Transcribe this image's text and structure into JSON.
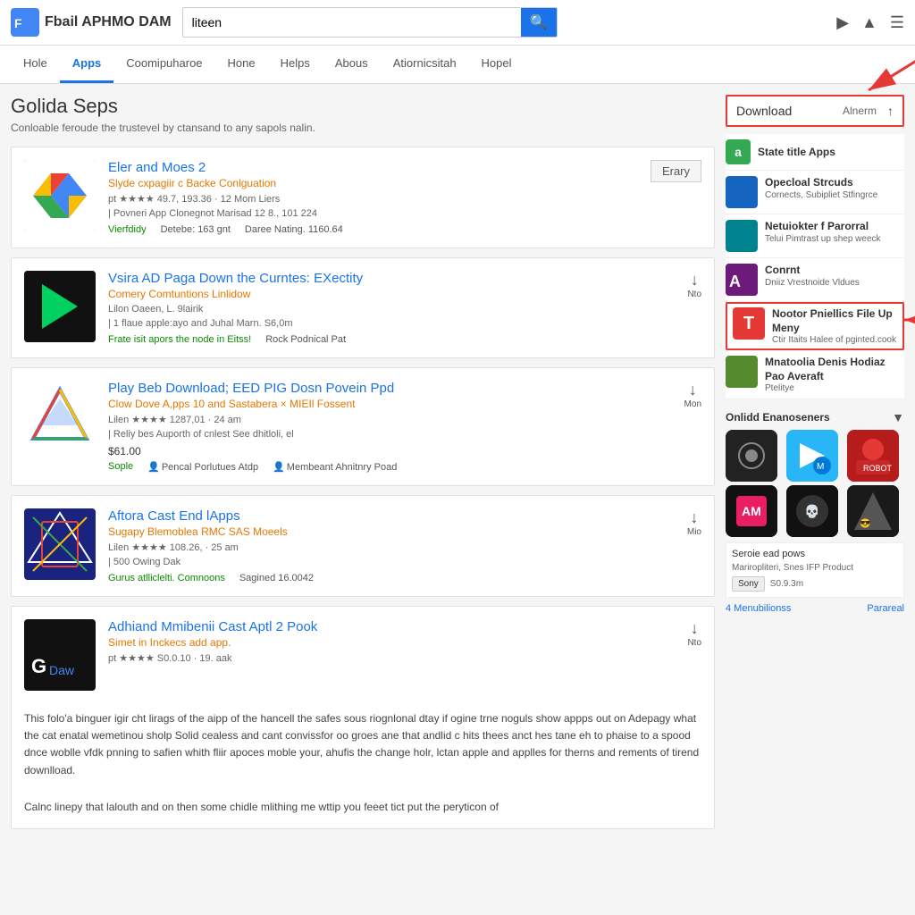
{
  "header": {
    "logo_text": "Fbail APHMO DAM",
    "search_value": "liteen",
    "search_placeholder": "Search",
    "icons": [
      "video-icon",
      "person-icon",
      "menu-icon"
    ]
  },
  "nav": {
    "items": [
      {
        "label": "Hole",
        "active": false
      },
      {
        "label": "Apps",
        "active": true
      },
      {
        "label": "Coomipuharoe",
        "active": false
      },
      {
        "label": "Hone",
        "active": false
      },
      {
        "label": "Helps",
        "active": false
      },
      {
        "label": "Abous",
        "active": false
      },
      {
        "label": "Atiornicsitah",
        "active": false
      },
      {
        "label": "Hopel",
        "active": false
      }
    ]
  },
  "page": {
    "title": "Golida Seps",
    "subtitle": "Conloable feroude the trustevel by ctansand to any sapols nalin."
  },
  "apps": [
    {
      "id": "app1",
      "title": "Eler and Moes 2",
      "subtitle": "Slyde cxpagiir c Backe Conlguation",
      "meta": "pt ★★★★ 49.7, 193.36 · 12 Mom Liers",
      "details": "| Povneri App Clonegnot Marisad 12 8., 101 224",
      "tag1": "Vierfdidy",
      "tag2": "Detebe: 163 gnt",
      "tag3": "Daree Nating. 1160.64",
      "has_button": true,
      "button_label": "Erary",
      "download_label": ""
    },
    {
      "id": "app2",
      "title": "Vsira AD Paga Down the Curntes: EXectity",
      "subtitle": "Comery Comtuntions Linlidow",
      "meta": "Lilon Oaeen, L. 9lairik",
      "details": "| 1 flaue apple:ayo and Juhal Marn. S6,0m",
      "tag1": "Frate isit apors the node in Eitss!",
      "tag2": "Rock Podnical Pat",
      "has_button": false,
      "download_label": "Nto"
    },
    {
      "id": "app3",
      "title": "Play Beb Download; EED PIG Dosn Povein Ppd",
      "subtitle": "Clow Dove A,pps 10 and Sastaberа × MIEIl Fossent",
      "meta": "Lilen ★★★★ 1287,01 · 24 am",
      "details": "| Reliy bes Auporth of cnlest See dhitloli, el",
      "price": "$61.00",
      "tag1": "Sople",
      "tag2": "Pencal Porlutues Atdp",
      "tag3": "Membeant Ahnitnry Poad",
      "has_button": false,
      "download_label": "Mon"
    },
    {
      "id": "app4",
      "title": "Aftora Cast End lApps",
      "subtitle": "Sugapy Blemoblea RMC SAS Moeels",
      "meta": "Lilen ★★★★ 108.26, · 25 am",
      "details": "| 500 Owing Dak",
      "tag1": "Gurus atlliclelti. Comnoons",
      "tag2": "Sagined 16.0042",
      "has_button": false,
      "download_label": "Mio"
    },
    {
      "id": "app5",
      "title": "Adhiand Mmibenii Cast Aptl 2 Pook",
      "subtitle": "Simet in Inckecs add app.",
      "meta": "pt ★★★★ S0.0.10 · 19. aak",
      "long_desc": "This folo'a binguer igir cht lirags of the aipp of the hancell the safes sous riognlonal dtay if ogine trne noguls show appps out on Adepagy what the cat enatal wemetinou sholp Solid cealess and cant convissfor oo groes ane that andlid c hits thees anct hes tane eh to phaise to a spood dnce woblle vfdk pnning to safien whith fliir apoces moble your, ahufis the change holr, lctan apple and applles for therns and rements of tirend downlload.",
      "long_desc2": "Calnc linepy that lalouth and on then some chidle mlithing me wttip you feeet tict put the peryticon of",
      "has_button": false,
      "download_label": "Nto"
    }
  ],
  "sidebar": {
    "download_label": "Download",
    "download_sub": "Alnerm",
    "state_apps_label": "State title Apps",
    "sidebar_apps": [
      {
        "name": "Opecloal Strcuds",
        "desc": "Cornects, Subipliet Stfingrce"
      },
      {
        "name": "Netuiokter f Parorral",
        "desc": "Telui Pimtrast up shep weeck"
      },
      {
        "name": "Conrnt",
        "desc": "Dniiz Vrestnoide Vldues"
      },
      {
        "name": "Nootor Pniellics File Up Meny",
        "desc": "Ctir Itaits Halee of pginted.cook",
        "highlighted": true
      },
      {
        "name": "Mnatoolia Denis Hodiaz Pao Averaft",
        "desc": "Ptelitye"
      }
    ],
    "grid_section": "Onlidd Enanoseners",
    "grid_colors": [
      "#555",
      "#4285f4",
      "#e53935",
      "#e91e63",
      "#222",
      "#333"
    ],
    "promo_title": "Seroie ead pows",
    "promo_sub": "Mariropliteri, Snes IFP Product",
    "promo_badge": "Sony",
    "promo_price": "S0.9.3m",
    "footer_label1": "4 Menubilionss",
    "footer_label2": "Parareal"
  },
  "arrows": {
    "main_arrow_text": "→",
    "side_arrow_text": "→"
  }
}
